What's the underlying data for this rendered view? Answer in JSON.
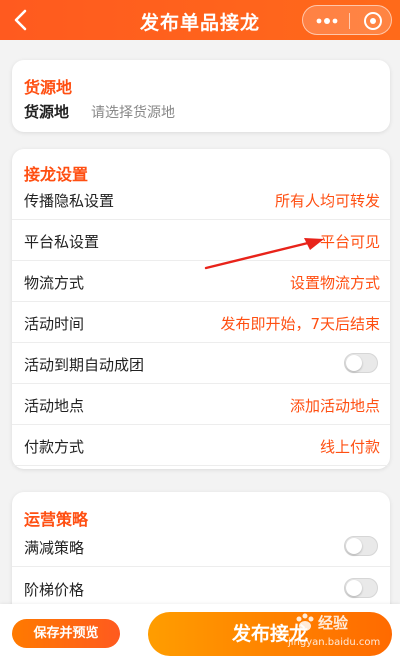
{
  "header": {
    "title": "发布单品接龙",
    "back_icon": "chevron-left-icon",
    "more_icon": "more-dots-icon",
    "close_icon": "target-circle-icon"
  },
  "origin_card": {
    "title": "货源地",
    "field_label": "货源地",
    "field_placeholder": "请选择货源地"
  },
  "settings_card": {
    "title": "接龙设置",
    "rows": [
      {
        "label": "传播隐私设置",
        "value": "所有人均可转发"
      },
      {
        "label": "平台私设置",
        "value": "平台可见"
      },
      {
        "label": "物流方式",
        "value": "设置物流方式"
      },
      {
        "label": "活动时间",
        "value": "发布即开始，7天后结束"
      },
      {
        "label": "活动到期自动成团",
        "toggle": false
      },
      {
        "label": "活动地点",
        "value": "添加活动地点"
      },
      {
        "label": "付款方式",
        "value": "线上付款"
      }
    ]
  },
  "ops_card": {
    "title": "运营策略",
    "rows": [
      {
        "label": "满减策略",
        "toggle": false
      },
      {
        "label": "阶梯价格",
        "toggle": false
      }
    ]
  },
  "footer": {
    "preview_label": "保存并预览",
    "publish_label": "发布接龙"
  },
  "watermark": {
    "brand": "经验",
    "url": "jingyan.baidu.com"
  },
  "colors": {
    "accent": "#ff4f12",
    "header": "#ff5a1f",
    "publish_button": "#ff8a00"
  }
}
